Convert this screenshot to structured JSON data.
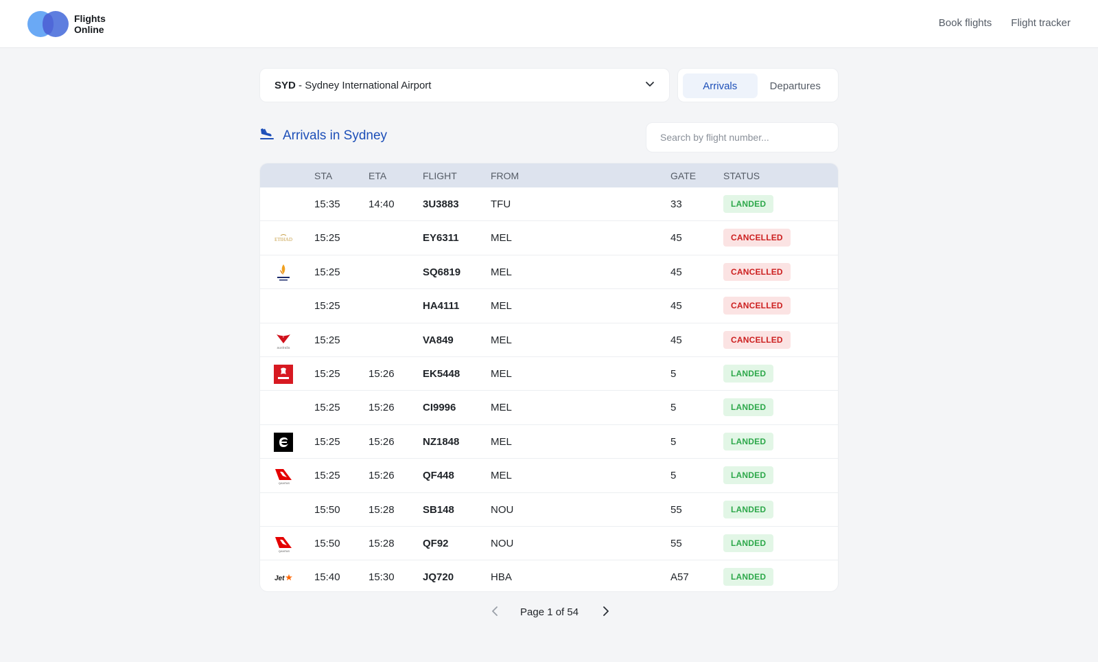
{
  "header": {
    "brand_line1": "Flights",
    "brand_line2": "Online",
    "nav": [
      "Book flights",
      "Flight tracker"
    ]
  },
  "airport": {
    "code": "SYD",
    "separator": " - ",
    "name": "Sydney International Airport"
  },
  "tabs": [
    {
      "label": "Arrivals",
      "active": true
    },
    {
      "label": "Departures",
      "active": false
    }
  ],
  "section": {
    "title": "Arrivals in Sydney"
  },
  "search": {
    "placeholder": "Search by flight number..."
  },
  "table": {
    "columns": {
      "sta": "STA",
      "eta": "ETA",
      "flight": "FLIGHT",
      "from": "FROM",
      "gate": "GATE",
      "status": "STATUS"
    },
    "rows": [
      {
        "logo": "",
        "sta": "15:35",
        "eta": "14:40",
        "flight": "3U3883",
        "from": "TFU",
        "gate": "33",
        "status": "LANDED"
      },
      {
        "logo": "etihad-logo",
        "sta": "15:25",
        "eta": "",
        "flight": "EY6311",
        "from": "MEL",
        "gate": "45",
        "status": "CANCELLED"
      },
      {
        "logo": "singapore-airlines-logo",
        "sta": "15:25",
        "eta": "",
        "flight": "SQ6819",
        "from": "MEL",
        "gate": "45",
        "status": "CANCELLED"
      },
      {
        "logo": "",
        "sta": "15:25",
        "eta": "",
        "flight": "HA4111",
        "from": "MEL",
        "gate": "45",
        "status": "CANCELLED"
      },
      {
        "logo": "virgin-australia-logo",
        "sta": "15:25",
        "eta": "",
        "flight": "VA849",
        "from": "MEL",
        "gate": "45",
        "status": "CANCELLED"
      },
      {
        "logo": "emirates-logo",
        "sta": "15:25",
        "eta": "15:26",
        "flight": "EK5448",
        "from": "MEL",
        "gate": "5",
        "status": "LANDED"
      },
      {
        "logo": "",
        "sta": "15:25",
        "eta": "15:26",
        "flight": "CI9996",
        "from": "MEL",
        "gate": "5",
        "status": "LANDED"
      },
      {
        "logo": "air-new-zealand-logo",
        "sta": "15:25",
        "eta": "15:26",
        "flight": "NZ1848",
        "from": "MEL",
        "gate": "5",
        "status": "LANDED"
      },
      {
        "logo": "qantas-logo",
        "sta": "15:25",
        "eta": "15:26",
        "flight": "QF448",
        "from": "MEL",
        "gate": "5",
        "status": "LANDED"
      },
      {
        "logo": "",
        "sta": "15:50",
        "eta": "15:28",
        "flight": "SB148",
        "from": "NOU",
        "gate": "55",
        "status": "LANDED"
      },
      {
        "logo": "qantas-logo",
        "sta": "15:50",
        "eta": "15:28",
        "flight": "QF92",
        "from": "NOU",
        "gate": "55",
        "status": "LANDED"
      },
      {
        "logo": "jetstar-logo",
        "sta": "15:40",
        "eta": "15:30",
        "flight": "JQ720",
        "from": "HBA",
        "gate": "A57",
        "status": "LANDED"
      }
    ]
  },
  "pagination": {
    "label": "Page 1 of 54"
  },
  "colors": {
    "accent": "#1d4fb8",
    "landed_bg": "#e2f6e6",
    "landed_text": "#2da84a",
    "cancelled_bg": "#fbe3e3",
    "cancelled_text": "#cc1f1f"
  }
}
